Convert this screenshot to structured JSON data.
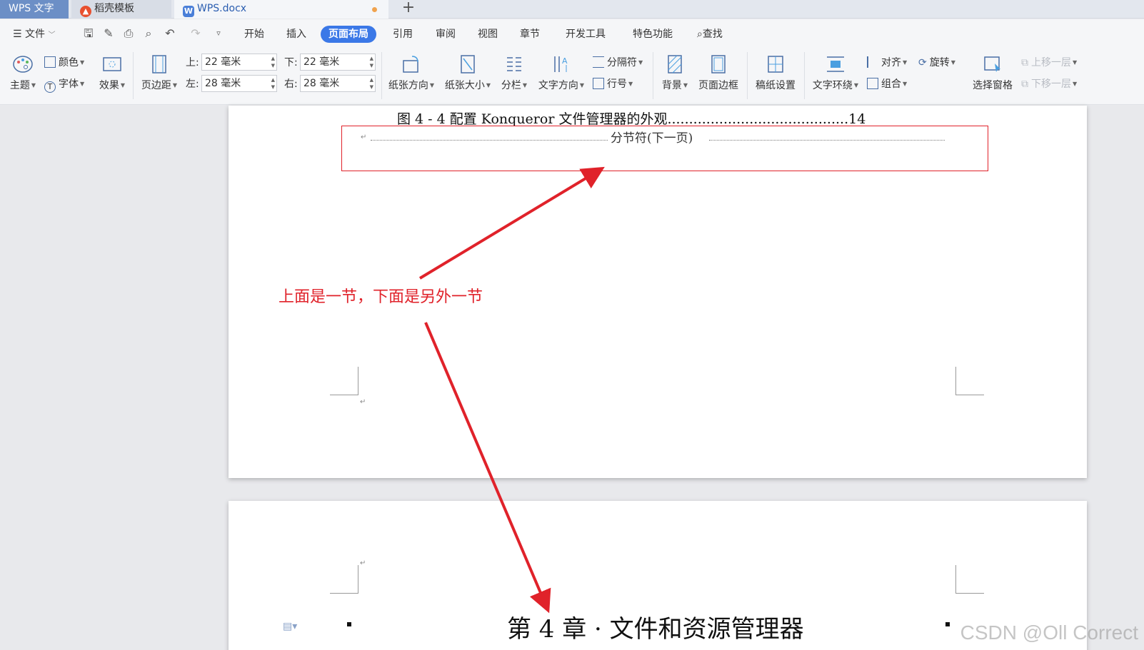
{
  "tabs": {
    "app": "WPS 文字",
    "daoke": "稻壳模板",
    "doc": "WPS.docx",
    "new_tab_icon": "plus-icon"
  },
  "menu": {
    "file": "文件",
    "items": [
      "开始",
      "插入",
      "页面布局",
      "引用",
      "审阅",
      "视图",
      "章节",
      "开发工具",
      "特色功能"
    ],
    "active": "页面布局",
    "search": "查找"
  },
  "ribbon": {
    "theme": "主题",
    "color": "颜色",
    "font": "字体",
    "effect": "效果",
    "margins": "页边距",
    "margin_top_label": "上:",
    "margin_top": "22 毫米",
    "margin_bottom_label": "下:",
    "margin_bottom": "22 毫米",
    "margin_left_label": "左:",
    "margin_left": "28 毫米",
    "margin_right_label": "右:",
    "margin_right": "28 毫米",
    "orientation": "纸张方向",
    "size": "纸张大小",
    "columns": "分栏",
    "text_direction": "文字方向",
    "breaks": "分隔符",
    "line_numbers": "行号",
    "background": "背景",
    "page_border": "页面边框",
    "draft_paper": "稿纸设置",
    "text_wrap": "文字环绕",
    "align": "对齐",
    "rotate": "旋转",
    "group": "组合",
    "selection_pane": "选择窗格",
    "bring_forward": "上移一层",
    "send_backward": "下移一层"
  },
  "document": {
    "toc_line": "图 4 - 4  配置 Konqueror 文件管理器的外观..........................................14",
    "section_break": "分节符(下一页)",
    "paragraph_mark": "↵",
    "annotation": "上面是一节，下面是另外一节",
    "chapter_title": "第 4 章 · 文件和资源管理器",
    "watermark": "CSDN @Oll Correct"
  },
  "colors": {
    "accent": "#3b78e7",
    "annotation": "#e0222a",
    "app_tab": "#6c8fc6"
  }
}
